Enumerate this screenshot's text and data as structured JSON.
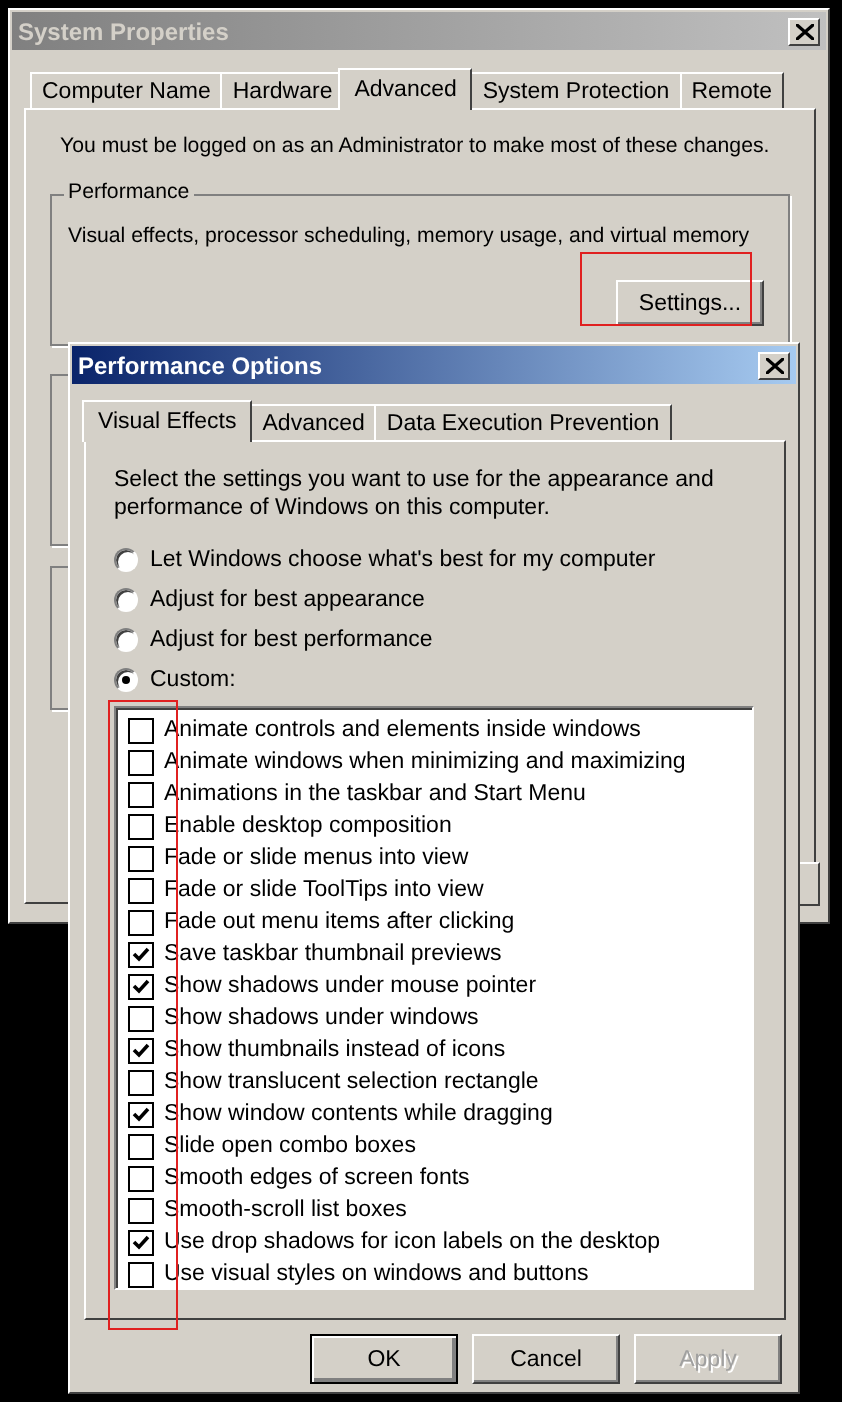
{
  "system_properties": {
    "title": "System Properties",
    "tabs": [
      {
        "label": "Computer Name",
        "selected": false
      },
      {
        "label": "Hardware",
        "selected": false
      },
      {
        "label": "Advanced",
        "selected": true
      },
      {
        "label": "System Protection",
        "selected": false
      },
      {
        "label": "Remote",
        "selected": false
      }
    ],
    "notice": "You must be logged on as an Administrator to make most of these changes.",
    "performance": {
      "title": "Performance",
      "description": "Visual effects, processor scheduling, memory usage, and virtual memory",
      "button": "Settings..."
    }
  },
  "performance_options": {
    "title": "Performance Options",
    "tabs": [
      {
        "label": "Visual Effects",
        "selected": true
      },
      {
        "label": "Advanced",
        "selected": false
      },
      {
        "label": "Data Execution Prevention",
        "selected": false
      }
    ],
    "description": "Select the settings you want to use for the appearance and performance of Windows on this computer.",
    "options": [
      {
        "label": "Let Windows choose what's best for my computer",
        "selected": false
      },
      {
        "label": "Adjust for best appearance",
        "selected": false
      },
      {
        "label": "Adjust for best performance",
        "selected": false
      },
      {
        "label": "Custom:",
        "selected": true
      }
    ],
    "effects": [
      {
        "label": "Animate controls and elements inside windows",
        "checked": false
      },
      {
        "label": "Animate windows when minimizing and maximizing",
        "checked": false
      },
      {
        "label": "Animations in the taskbar and Start Menu",
        "checked": false
      },
      {
        "label": "Enable desktop composition",
        "checked": false
      },
      {
        "label": "Fade or slide menus into view",
        "checked": false
      },
      {
        "label": "Fade or slide ToolTips into view",
        "checked": false
      },
      {
        "label": "Fade out menu items after clicking",
        "checked": false
      },
      {
        "label": "Save taskbar thumbnail previews",
        "checked": true
      },
      {
        "label": "Show shadows under mouse pointer",
        "checked": true
      },
      {
        "label": "Show shadows under windows",
        "checked": false
      },
      {
        "label": "Show thumbnails instead of icons",
        "checked": true
      },
      {
        "label": "Show translucent selection rectangle",
        "checked": false
      },
      {
        "label": "Show window contents while dragging",
        "checked": true
      },
      {
        "label": "Slide open combo boxes",
        "checked": false
      },
      {
        "label": "Smooth edges of screen fonts",
        "checked": false
      },
      {
        "label": "Smooth-scroll list boxes",
        "checked": false
      },
      {
        "label": "Use drop shadows for icon labels on the desktop",
        "checked": true
      },
      {
        "label": "Use visual styles on windows and buttons",
        "checked": false
      }
    ],
    "buttons": [
      {
        "label": "OK",
        "default": true,
        "disabled": false
      },
      {
        "label": "Cancel",
        "default": false,
        "disabled": false
      },
      {
        "label": "Apply",
        "default": false,
        "disabled": true
      }
    ]
  }
}
